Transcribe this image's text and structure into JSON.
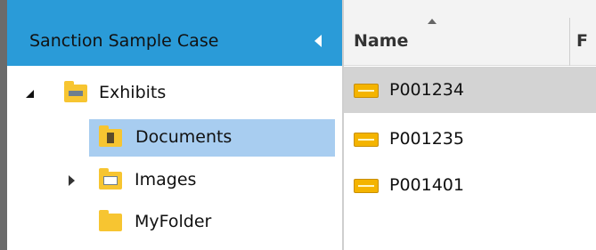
{
  "sidebar": {
    "title": "Sanction Sample Case",
    "tree": [
      {
        "label": "Exhibits",
        "expanded": true,
        "icon": "folder-icon"
      },
      {
        "label": "Documents",
        "selected": true,
        "icon": "folder-documents-icon"
      },
      {
        "label": "Images",
        "expanded": false,
        "icon": "folder-images-icon"
      },
      {
        "label": "MyFolder",
        "icon": "folder-icon"
      }
    ]
  },
  "list": {
    "columns": [
      {
        "label": "Name",
        "sorted": "ascending"
      },
      {
        "label": "F"
      }
    ],
    "rows": [
      {
        "name": "P001234",
        "selected": true,
        "icon": "exhibit-icon"
      },
      {
        "name": "P001235",
        "icon": "exhibit-icon"
      },
      {
        "name": "P001401",
        "icon": "exhibit-icon"
      }
    ]
  },
  "colors": {
    "header_accent": "#2a9bd8",
    "tree_selected": "#a8cdf0",
    "row_selected": "#d3d3d3",
    "folder": "#f7c531"
  }
}
